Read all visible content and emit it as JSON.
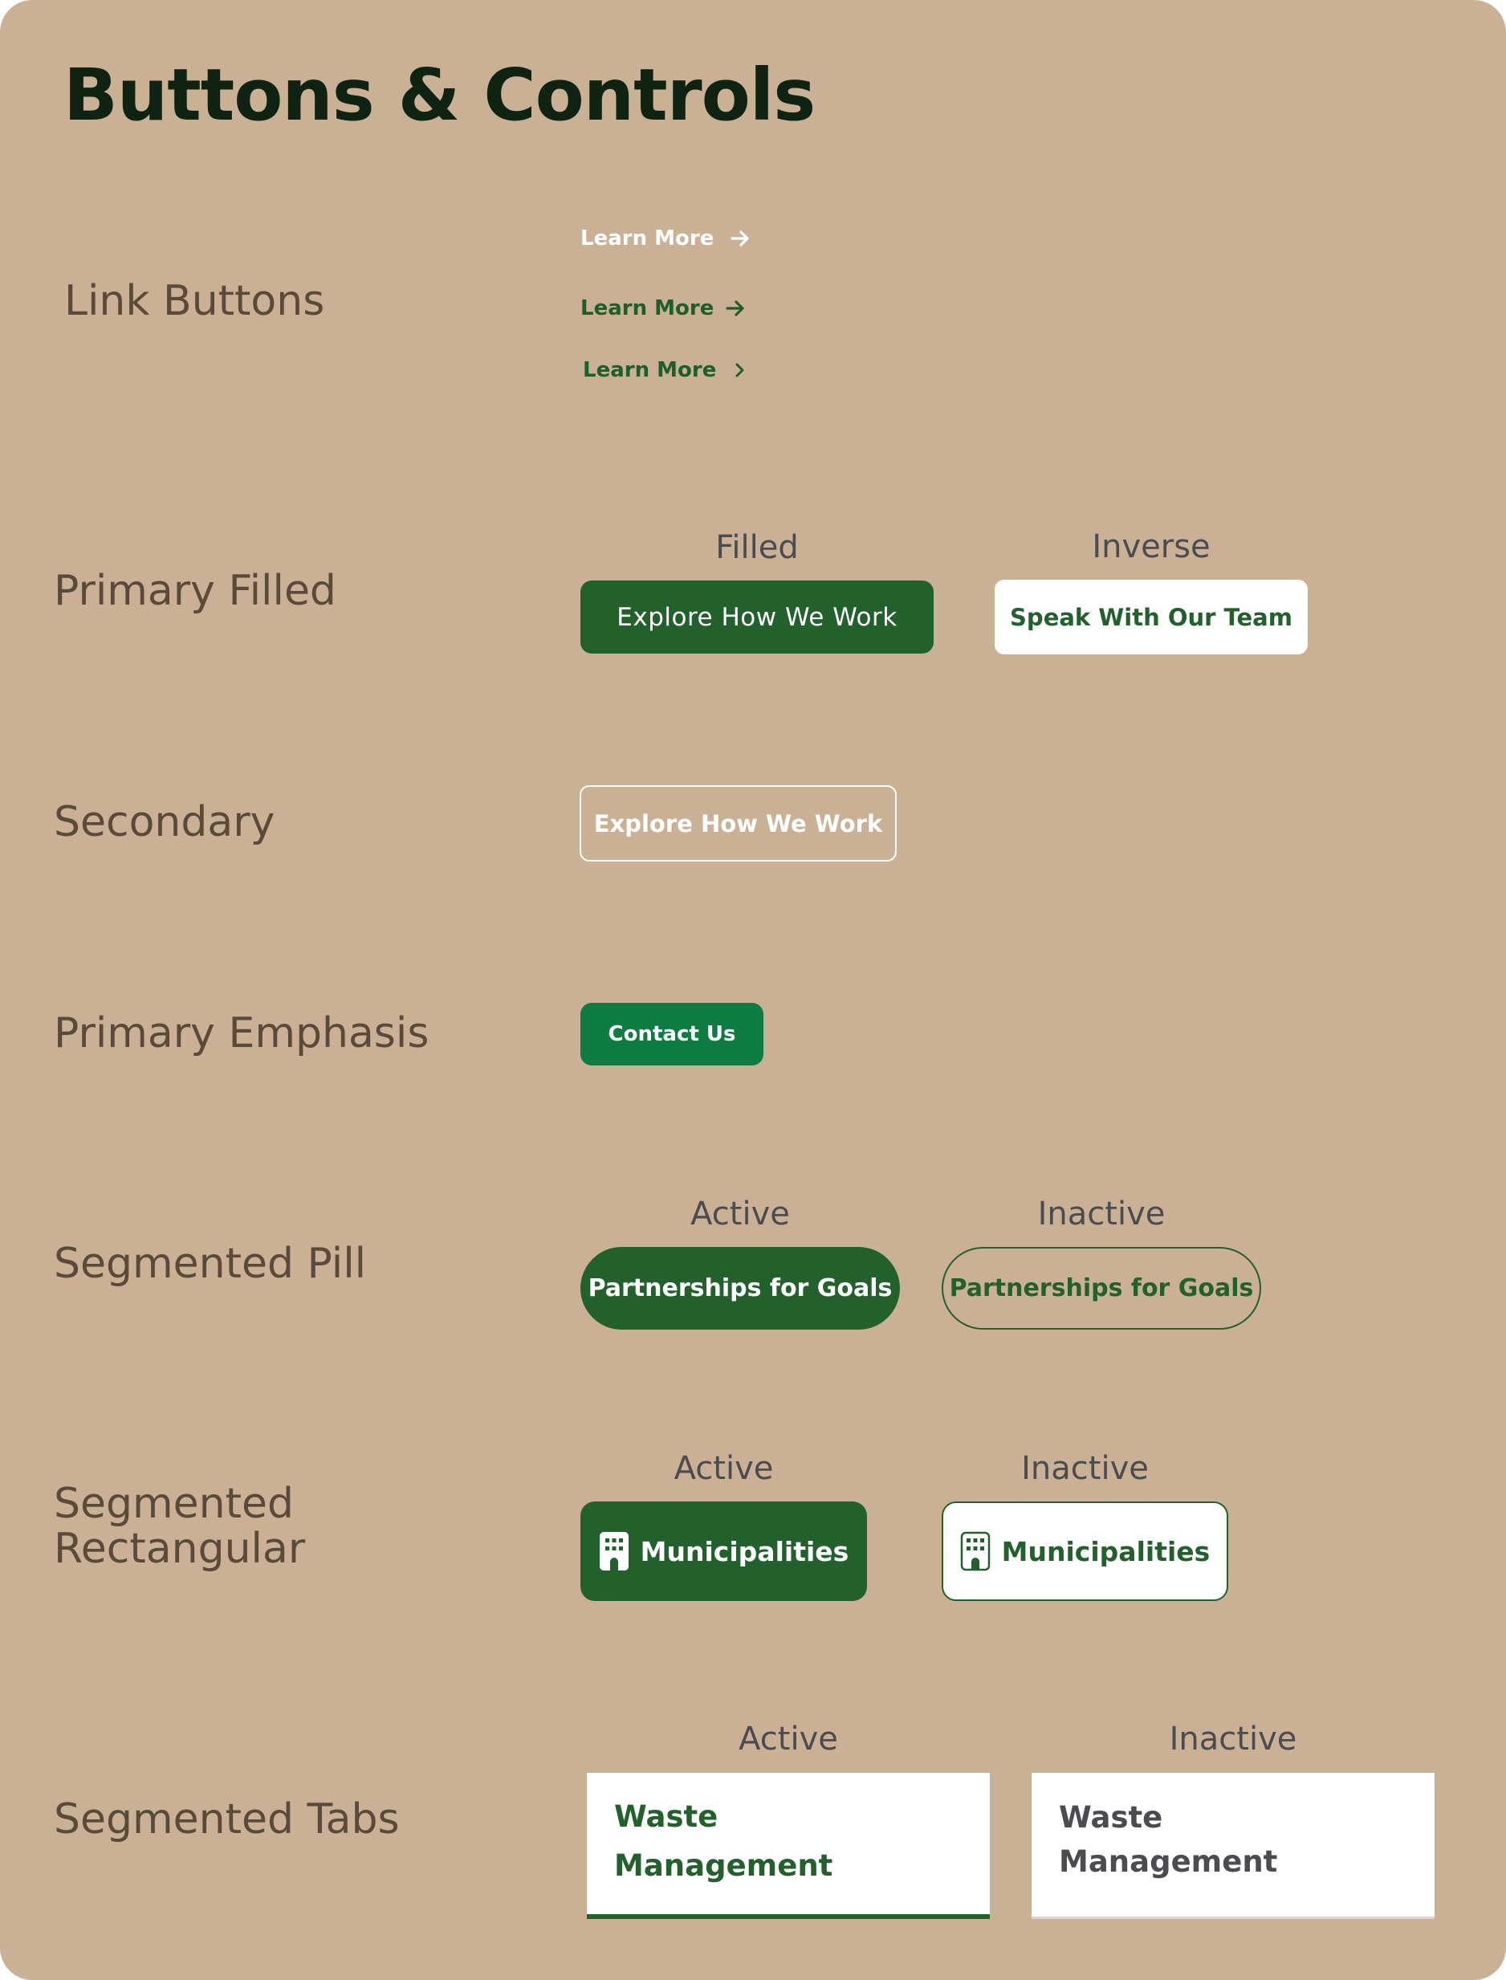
{
  "page": {
    "title": "Buttons & Controls"
  },
  "colors": {
    "background": "#CAB196",
    "brand_green": "#22602C",
    "emphasis_green": "#0E7B40",
    "white": "#FFFFFF"
  },
  "link_buttons": {
    "label": "Link Buttons",
    "items": [
      {
        "text": "Learn More",
        "icon": "arrow-right-icon",
        "style": "light"
      },
      {
        "text": "Learn More",
        "icon": "arrow-right-icon",
        "style": "green"
      },
      {
        "text": "Learn More",
        "icon": "chevron-right-icon",
        "style": "green"
      }
    ]
  },
  "primary_filled": {
    "label": "Primary Filled",
    "filled": {
      "state": "Filled",
      "text": "Explore How We Work"
    },
    "inverse": {
      "state": "Inverse",
      "text": "Speak With Our Team"
    }
  },
  "secondary": {
    "label": "Secondary",
    "button": {
      "text": "Explore How We Work"
    }
  },
  "primary_emphasis": {
    "label": "Primary Emphasis",
    "button": {
      "text": "Contact Us"
    }
  },
  "segmented_pill": {
    "label": "Segmented Pill",
    "active": {
      "state": "Active",
      "text": "Partnerships for Goals"
    },
    "inactive": {
      "state": "Inactive",
      "text": "Partnerships for Goals"
    }
  },
  "segmented_rectangular": {
    "label": "Segmented\nRectangular",
    "active": {
      "state": "Active",
      "text": "Municipalities",
      "icon": "building-icon"
    },
    "inactive": {
      "state": "Inactive",
      "text": "Municipalities",
      "icon": "building-icon"
    }
  },
  "segmented_tabs": {
    "label": "Segmented Tabs",
    "active": {
      "state": "Active",
      "text": "Waste\nManagement"
    },
    "inactive": {
      "state": "Inactive",
      "text": "Waste\nManagement"
    }
  }
}
